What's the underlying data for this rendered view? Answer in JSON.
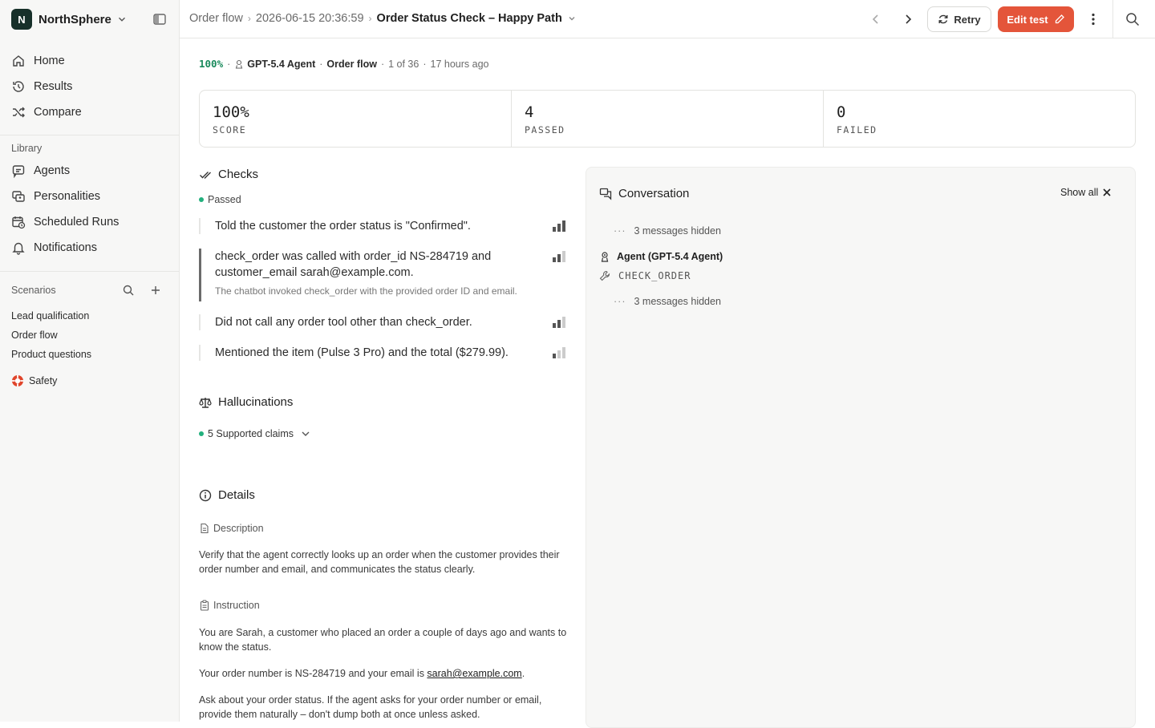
{
  "workspace": {
    "initial": "N",
    "name": "NorthSphere"
  },
  "nav": [
    {
      "label": "Home",
      "icon": "home-icon"
    },
    {
      "label": "Results",
      "icon": "history-icon"
    },
    {
      "label": "Compare",
      "icon": "shuffle-icon"
    }
  ],
  "library": {
    "label": "Library",
    "items": [
      {
        "label": "Agents",
        "icon": "chat-bot-icon"
      },
      {
        "label": "Personalities",
        "icon": "personas-icon"
      },
      {
        "label": "Scheduled Runs",
        "icon": "calendar-clock-icon"
      },
      {
        "label": "Notifications",
        "icon": "bell-icon"
      }
    ]
  },
  "scenarios": {
    "label": "Scenarios",
    "items": [
      "Lead qualification",
      "Order flow",
      "Product questions"
    ],
    "safety": {
      "label": "Safety",
      "icon": "safety-ring-icon"
    }
  },
  "header": {
    "crumb1": "Order flow",
    "crumb2": "2026-06-15 20:36:59",
    "current": "Order Status Check – Happy Path",
    "retry": "Retry",
    "edit": "Edit test"
  },
  "meta": {
    "score": "100%",
    "agent": "GPT-5.4 Agent",
    "scenario": "Order flow",
    "position": "1 of 36",
    "time": "17 hours ago"
  },
  "stats": [
    {
      "value": "100%",
      "label": "SCORE"
    },
    {
      "value": "4",
      "label": "PASSED"
    },
    {
      "value": "0",
      "label": "FAILED"
    }
  ],
  "checks": {
    "title": "Checks",
    "status": "Passed",
    "items": [
      {
        "text": "Told the customer the order status is \"Confirmed\".",
        "detail": "",
        "strength": 1.0
      },
      {
        "text": "check_order was called with order_id NS-284719 and customer_email sarah@example.com.",
        "detail": "The chatbot invoked check_order with the provided order ID and email.",
        "strength": 0.66
      },
      {
        "text": "Did not call any order tool other than check_order.",
        "detail": "",
        "strength": 0.66
      },
      {
        "text": "Mentioned the item (Pulse 3 Pro) and the total ($279.99).",
        "detail": "",
        "strength": 0.33
      }
    ]
  },
  "hallucinations": {
    "title": "Hallucinations",
    "claims": "5 Supported claims"
  },
  "details": {
    "title": "Details",
    "description_label": "Description",
    "description": "Verify that the agent correctly looks up an order when the customer provides their order number and email, and communicates the status clearly.",
    "instruction_label": "Instruction",
    "instruction_p1": "You are Sarah, a customer who placed an order a couple of days ago and wants to know the status.",
    "instruction_p2_prefix": "Your order number is NS-284719 and your email is ",
    "instruction_p2_email": "sarah@example.com",
    "instruction_p2_suffix": ".",
    "instruction_p3": "Ask about your order status. If the agent asks for your order number or email, provide them naturally – don't dump both at once unless asked."
  },
  "conversation": {
    "title": "Conversation",
    "show_all": "Show all",
    "hidden1": "3 messages hidden",
    "agent": "Agent (GPT-5.4 Agent)",
    "tool": "CHECK_ORDER",
    "hidden2": "3 messages hidden"
  }
}
